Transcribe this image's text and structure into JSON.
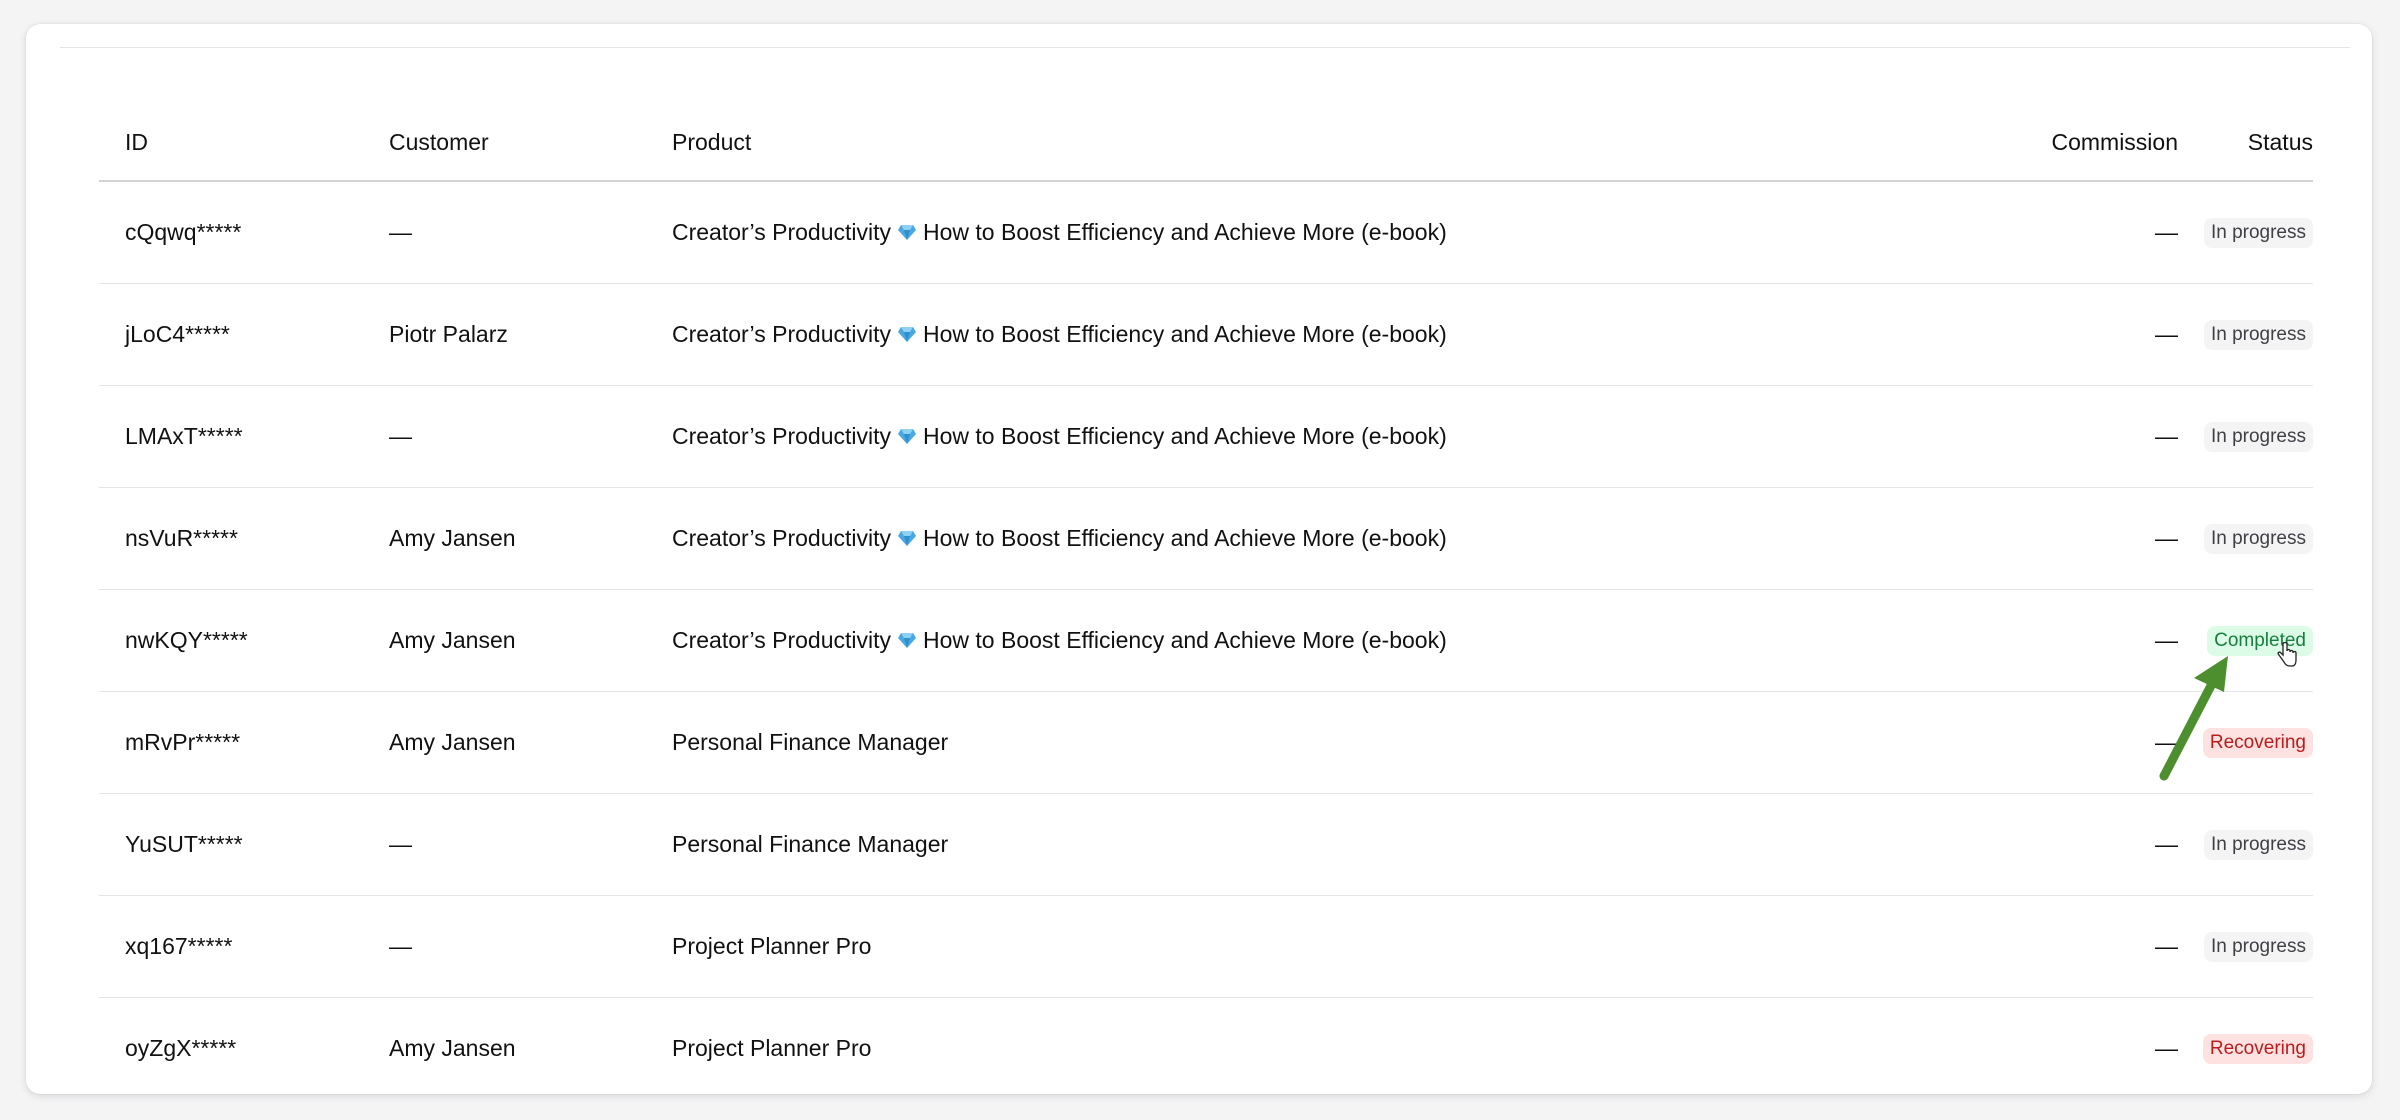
{
  "colors": {
    "in_progress_bg": "#f4f4f5",
    "in_progress_fg": "#3f3f46",
    "completed_bg": "#dcfce7",
    "completed_fg": "#15803d",
    "recovering_bg": "#fee2e2",
    "recovering_fg": "#b91c1c",
    "arrow": "#4d8f2f",
    "gem": "#4aa8e0"
  },
  "table": {
    "headers": {
      "id": "ID",
      "customer": "Customer",
      "product": "Product",
      "commission": "Commission",
      "status": "Status"
    },
    "rows": [
      {
        "id": "cQqwq*****",
        "customer": "—",
        "product_prefix": "Creator’s Productivity",
        "product_gem": true,
        "product_suffix": "How to Boost Efficiency and Achieve More (e-book)",
        "commission": "—",
        "status": "In progress",
        "status_kind": "in_progress"
      },
      {
        "id": "jLoC4*****",
        "customer": "Piotr Palarz",
        "product_prefix": "Creator’s Productivity",
        "product_gem": true,
        "product_suffix": "How to Boost Efficiency and Achieve More (e-book)",
        "commission": "—",
        "status": "In progress",
        "status_kind": "in_progress"
      },
      {
        "id": "LMAxT*****",
        "customer": "—",
        "product_prefix": "Creator’s Productivity",
        "product_gem": true,
        "product_suffix": "How to Boost Efficiency and Achieve More (e-book)",
        "commission": "—",
        "status": "In progress",
        "status_kind": "in_progress"
      },
      {
        "id": "nsVuR*****",
        "customer": "Amy Jansen",
        "product_prefix": "Creator’s Productivity",
        "product_gem": true,
        "product_suffix": "How to Boost Efficiency and Achieve More (e-book)",
        "commission": "—",
        "status": "In progress",
        "status_kind": "in_progress"
      },
      {
        "id": "nwKQY*****",
        "customer": "Amy Jansen",
        "product_prefix": "Creator’s Productivity",
        "product_gem": true,
        "product_suffix": "How to Boost Efficiency and Achieve More (e-book)",
        "commission": "—",
        "status": "Completed",
        "status_kind": "completed"
      },
      {
        "id": "mRvPr*****",
        "customer": "Amy Jansen",
        "product_prefix": "Personal Finance Manager",
        "product_gem": false,
        "product_suffix": "",
        "commission": "—",
        "status": "Recovering",
        "status_kind": "recovering"
      },
      {
        "id": "YuSUT*****",
        "customer": "—",
        "product_prefix": "Personal Finance Manager",
        "product_gem": false,
        "product_suffix": "",
        "commission": "—",
        "status": "In progress",
        "status_kind": "in_progress"
      },
      {
        "id": "xq167*****",
        "customer": "—",
        "product_prefix": "Project Planner Pro",
        "product_gem": false,
        "product_suffix": "",
        "commission": "—",
        "status": "In progress",
        "status_kind": "in_progress"
      },
      {
        "id": "oyZgX*****",
        "customer": "Amy Jansen",
        "product_prefix": "Project Planner Pro",
        "product_gem": false,
        "product_suffix": "",
        "commission": "—",
        "status": "Recovering",
        "status_kind": "recovering"
      }
    ]
  }
}
